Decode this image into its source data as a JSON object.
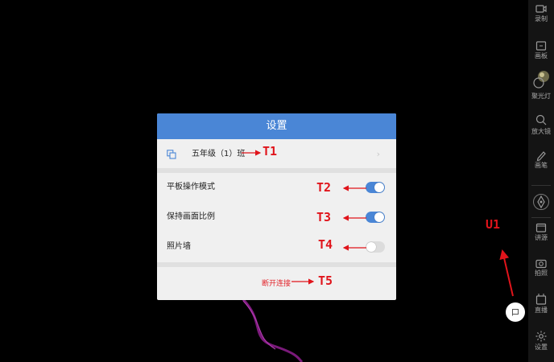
{
  "dialog": {
    "title": "设置",
    "class_name": "五年级（1）班",
    "settings": [
      {
        "label": "平板操作模式",
        "state": "on"
      },
      {
        "label": "保持画面比例",
        "state": "on"
      },
      {
        "label": "照片墙",
        "state": "off"
      }
    ],
    "disconnect_label": "断开连接"
  },
  "annotations": {
    "t1": "T1",
    "t2": "T2",
    "t3": "T3",
    "t4": "T4",
    "t5": "T5",
    "u1": "U1"
  },
  "toolbar": {
    "items": [
      {
        "label": "录制",
        "icon": "record-icon"
      },
      {
        "label": "画板",
        "icon": "drawing-board-icon"
      },
      {
        "label": "聚光灯",
        "icon": "spotlight-icon"
      },
      {
        "label": "放大镜",
        "icon": "magnifier-icon"
      },
      {
        "label": "画笔",
        "icon": "pen-icon"
      },
      {
        "label": "",
        "icon": "compass-icon"
      },
      {
        "label": "讲源",
        "icon": "source-icon"
      },
      {
        "label": "拍照",
        "icon": "camera-icon"
      },
      {
        "label": "直播",
        "icon": "live-icon"
      },
      {
        "label": "设置",
        "icon": "settings-icon"
      }
    ]
  },
  "colors": {
    "accent": "#4a86d6",
    "annotation": "#e0141b",
    "disconnect": "#e2232a"
  }
}
